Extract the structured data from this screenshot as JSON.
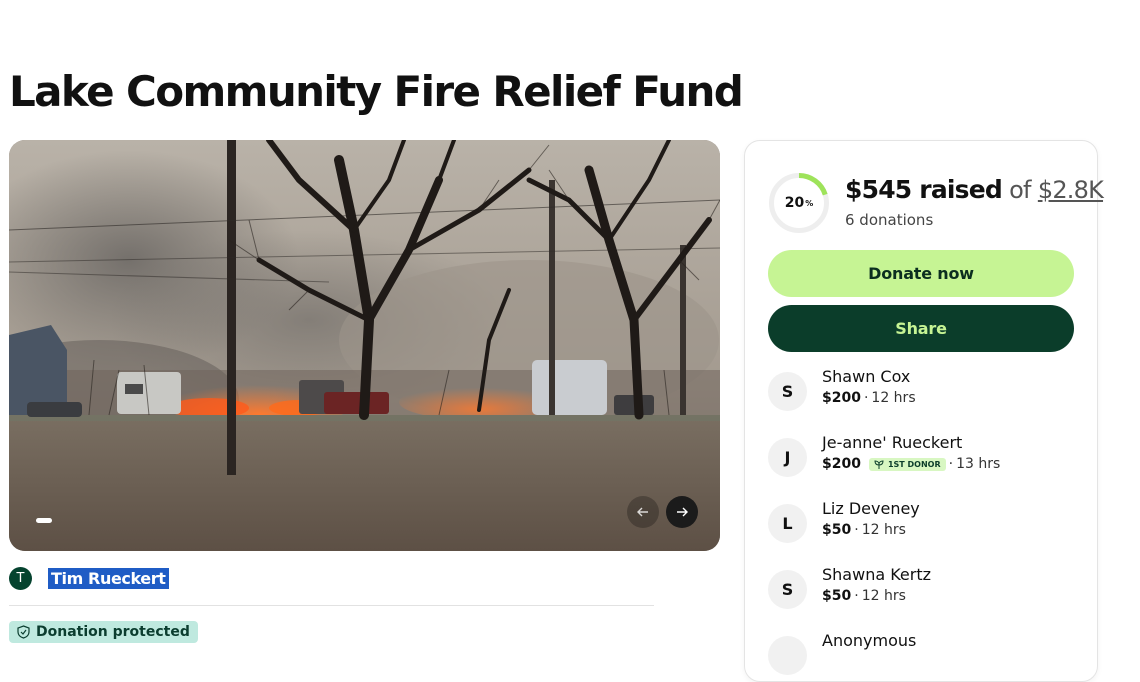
{
  "page": {
    "title": "Lake Community Fire Relief Fund"
  },
  "hero": {
    "image_alt": "Grass fire burning behind trees near parked vehicles",
    "prev_icon": "arrow-left-icon",
    "next_icon": "arrow-right-icon"
  },
  "organizer": {
    "initial": "T",
    "name": "Tim Rueckert"
  },
  "protection": {
    "label": "Donation protected",
    "icon": "shield-icon"
  },
  "progress": {
    "percent_value": 20,
    "percent_label": "20",
    "percent_sign": "%",
    "raised": "$545 raised",
    "of": "of",
    "goal": "$2.8K",
    "donations": "6 donations"
  },
  "actions": {
    "donate_label": "Donate now",
    "share_label": "Share"
  },
  "donors": [
    {
      "initial": "S",
      "name": "Shawn Cox",
      "amount": "$200",
      "time": "12 hrs"
    },
    {
      "initial": "J",
      "name": "Je-anne' Rueckert",
      "amount": "$200",
      "badge": "1ST DONOR",
      "time": "13 hrs"
    },
    {
      "initial": "L",
      "name": "Liz Deveney",
      "amount": "$50",
      "time": "12 hrs"
    },
    {
      "initial": "S",
      "name": "Shawna Kertz",
      "amount": "$50",
      "time": "12 hrs"
    },
    {
      "initial": "",
      "name": "Anonymous",
      "amount": "",
      "time": ""
    }
  ],
  "colors": {
    "brand_dark": "#0b3d2a",
    "brand_light": "#c6f494",
    "progress_track": "#eeeeee",
    "progress_fill": "#9ee35a",
    "highlight": "#1f5cc5"
  }
}
